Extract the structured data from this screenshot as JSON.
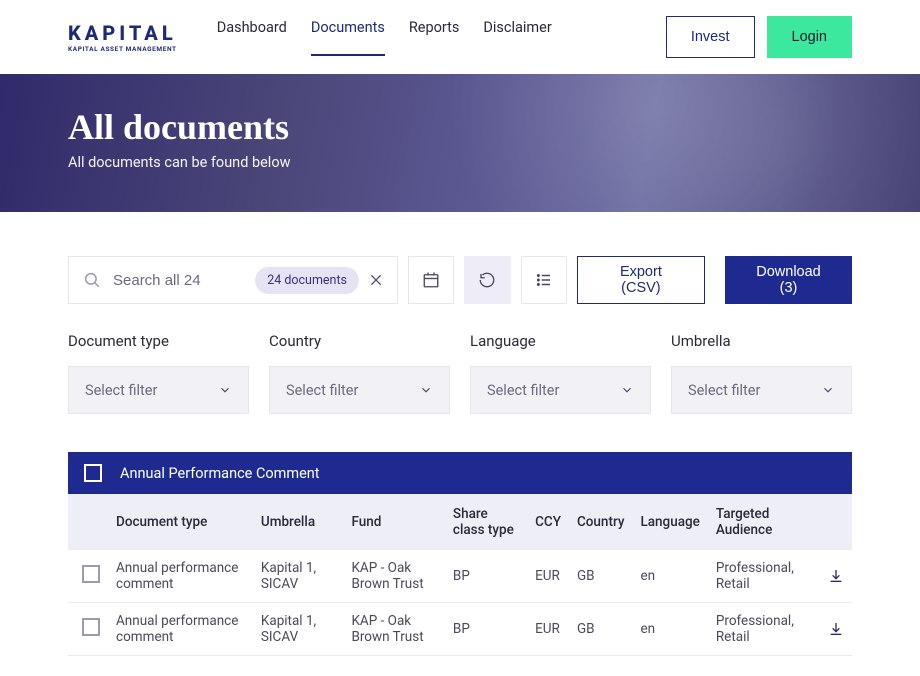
{
  "brand": {
    "name": "KAPITAL",
    "tagline": "KAPITAL ASSET MANAGEMENT"
  },
  "nav": {
    "items": [
      {
        "label": "Dashboard",
        "active": false
      },
      {
        "label": "Documents",
        "active": true
      },
      {
        "label": "Reports",
        "active": false
      },
      {
        "label": "Disclaimer",
        "active": false
      }
    ],
    "invest": "Invest",
    "login": "Login"
  },
  "hero": {
    "title": "All documents",
    "subtitle": "All documents can be found below"
  },
  "toolbar": {
    "search_placeholder": "Search all 24",
    "chip": "24 documents",
    "export_label": "Export (CSV)",
    "download_label": "Download (3)"
  },
  "filters": [
    {
      "label": "Document type",
      "placeholder": "Select filter"
    },
    {
      "label": "Country",
      "placeholder": "Select filter"
    },
    {
      "label": "Language",
      "placeholder": "Select filter"
    },
    {
      "label": "Umbrella",
      "placeholder": "Select filter"
    }
  ],
  "table": {
    "group_title": "Annual Performance Comment",
    "columns": [
      "Document type",
      "Umbrella",
      "Fund",
      "Share class type",
      "CCY",
      "Country",
      "Language",
      "Targeted Audience"
    ],
    "rows": [
      {
        "doc": "Annual performance comment",
        "umb": "Kapital 1, SICAV",
        "fund": "KAP - Oak Brown Trust",
        "share": "BP",
        "ccy": "EUR",
        "country": "GB",
        "lang": "en",
        "aud": "Professional, Retail"
      },
      {
        "doc": "Annual performance comment",
        "umb": "Kapital 1, SICAV",
        "fund": "KAP - Oak Brown Trust",
        "share": "BP",
        "ccy": "EUR",
        "country": "GB",
        "lang": "en",
        "aud": "Professional, Retail"
      }
    ]
  }
}
